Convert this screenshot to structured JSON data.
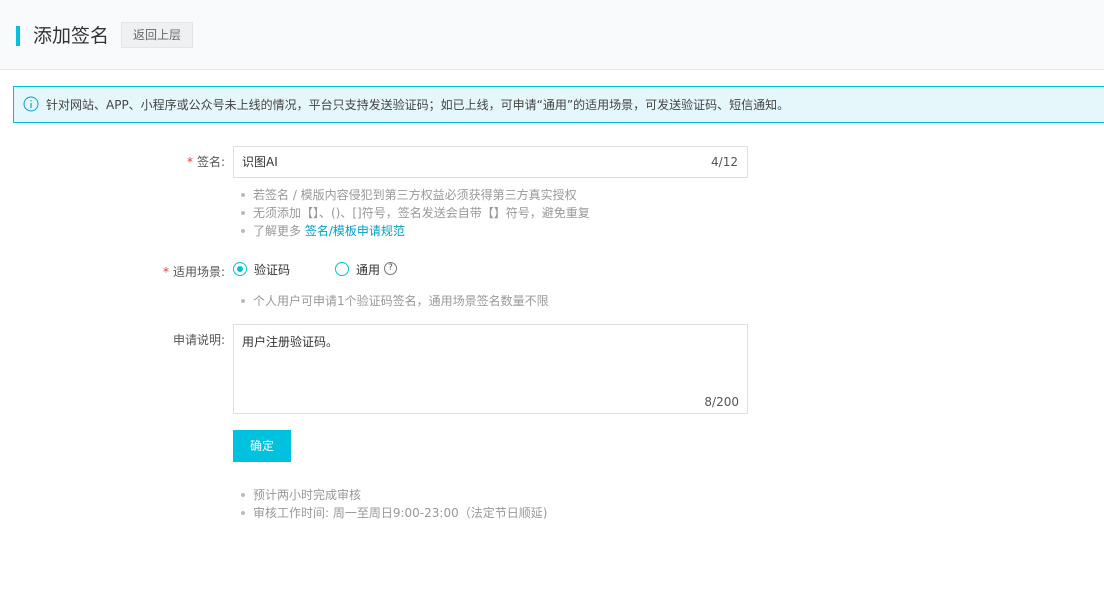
{
  "header": {
    "title": "添加签名",
    "back_button": "返回上层"
  },
  "notice": {
    "icon": "info-icon",
    "text": "针对网站、APP、小程序或公众号未上线的情况，平台只支持发送验证码；如已上线，可申请“通用”的适用场景，可发送验证码、短信通知。"
  },
  "form": {
    "signature": {
      "required_mark": "*",
      "label": "签名:",
      "value": "识图AI",
      "counter": "4/12",
      "tips": [
        "若签名 / 模版内容侵犯到第三方权益必须获得第三方真实授权",
        "无须添加【】、()、[]符号，签名发送会自带【】符号，避免重复"
      ],
      "tip_more_prefix": "了解更多 ",
      "tip_more_link": "签名/模板申请规范"
    },
    "scenario": {
      "required_mark": "*",
      "label": "适用场景:",
      "options": [
        {
          "label": "验证码",
          "checked": true
        },
        {
          "label": "通用",
          "checked": false
        }
      ],
      "help_icon": "?",
      "tip": "个人用户可申请1个验证码签名，通用场景签名数量不限"
    },
    "description": {
      "label": "申请说明:",
      "value": "用户注册验证码。",
      "counter": "8/200"
    },
    "confirm_button": "确定",
    "footer_tips": [
      "预计两小时完成审核",
      "审核工作时间: 周一至周日9:00-23:00（法定节日顺延)"
    ]
  },
  "colors": {
    "accent": "#00c1de",
    "required": "#e4393c",
    "link": "#00a2c8"
  }
}
